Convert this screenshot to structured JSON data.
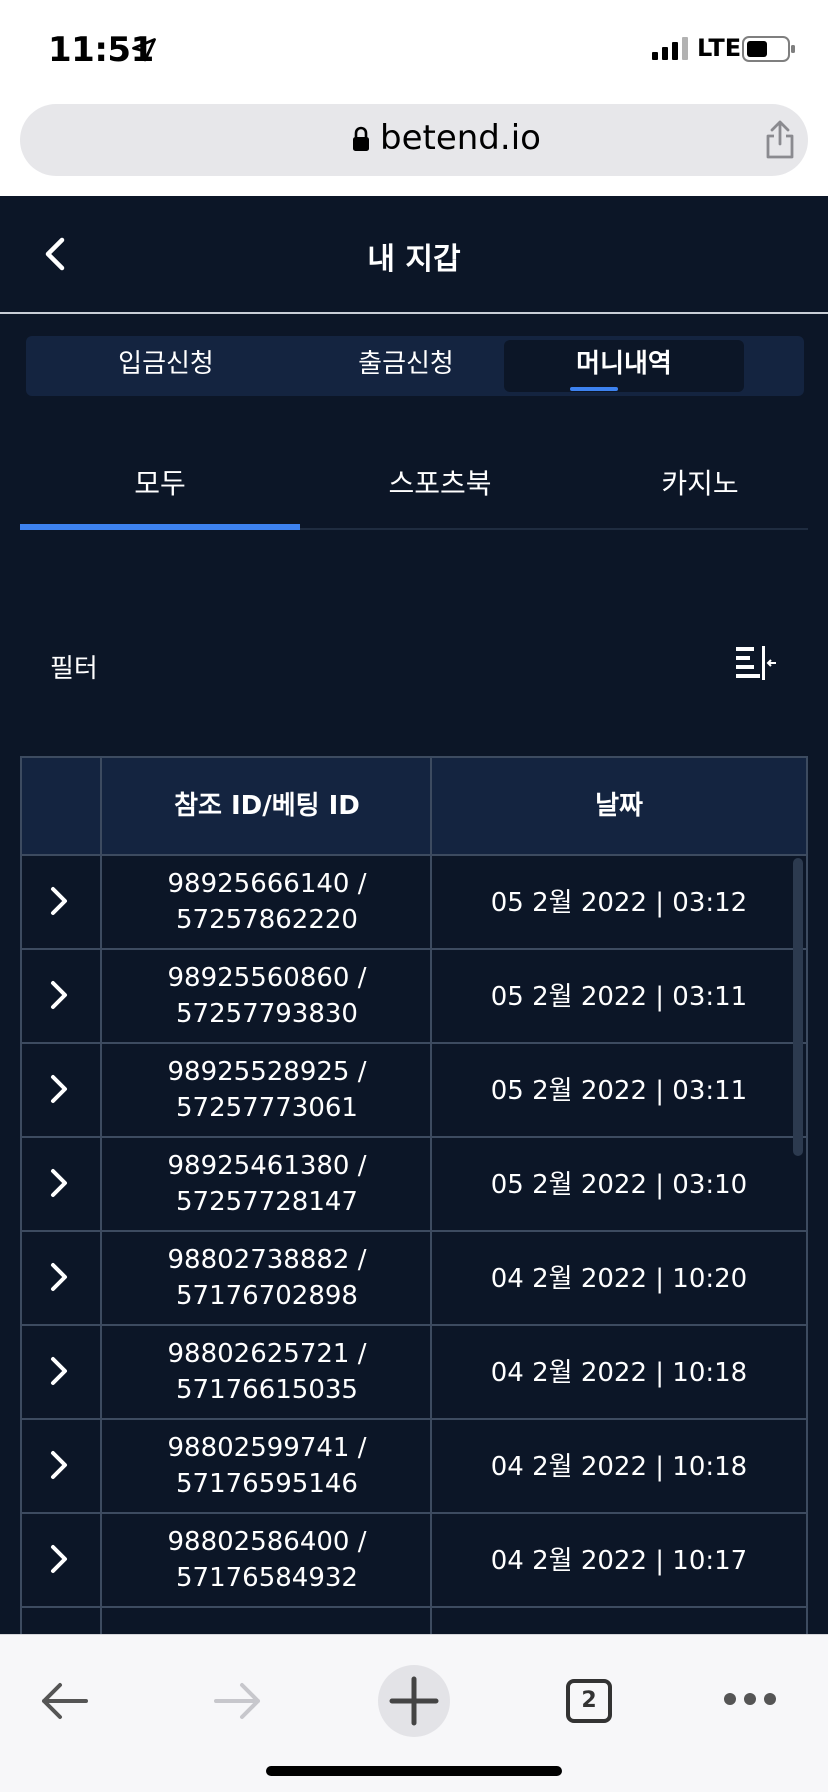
{
  "status_bar": {
    "time": "11:51",
    "network": "LTE",
    "icons": [
      "location-arrow-icon",
      "signal-icon",
      "battery-icon"
    ]
  },
  "browser": {
    "url": "betend.io",
    "icons": [
      "lock-icon",
      "share-icon"
    ]
  },
  "header": {
    "title": "내 지갑"
  },
  "segments": [
    {
      "label": "입금신청",
      "active": false
    },
    {
      "label": "출금신청",
      "active": false
    },
    {
      "label": "머니내역",
      "active": true
    }
  ],
  "categories": [
    {
      "label": "모두",
      "active": true
    },
    {
      "label": "스포츠북",
      "active": false
    },
    {
      "label": "카지노",
      "active": false
    }
  ],
  "filter": {
    "label": "필터"
  },
  "table": {
    "headers": [
      "참조 ID/베팅 ID",
      "날짜"
    ],
    "rows": [
      {
        "ref_line1": "98925666140 /",
        "ref_line2": "57257862220",
        "date": "05 2월 2022 | 03:12"
      },
      {
        "ref_line1": "98925560860 /",
        "ref_line2": "57257793830",
        "date": "05 2월 2022 | 03:11"
      },
      {
        "ref_line1": "98925528925 /",
        "ref_line2": "57257773061",
        "date": "05 2월 2022 | 03:11"
      },
      {
        "ref_line1": "98925461380 /",
        "ref_line2": "57257728147",
        "date": "05 2월 2022 | 03:10"
      },
      {
        "ref_line1": "98802738882 /",
        "ref_line2": "57176702898",
        "date": "04 2월 2022 | 10:20"
      },
      {
        "ref_line1": "98802625721 /",
        "ref_line2": "57176615035",
        "date": "04 2월 2022 | 10:18"
      },
      {
        "ref_line1": "98802599741 /",
        "ref_line2": "57176595146",
        "date": "04 2월 2022 | 10:18"
      },
      {
        "ref_line1": "98802586400 /",
        "ref_line2": "57176584932",
        "date": "04 2월 2022 | 10:17"
      }
    ]
  },
  "toolbar": {
    "tab_count": "2"
  },
  "colors": {
    "app_bg": "#0c1627",
    "panel_bg": "#142440",
    "accent": "#3d82f0",
    "border": "#3d4b60"
  }
}
